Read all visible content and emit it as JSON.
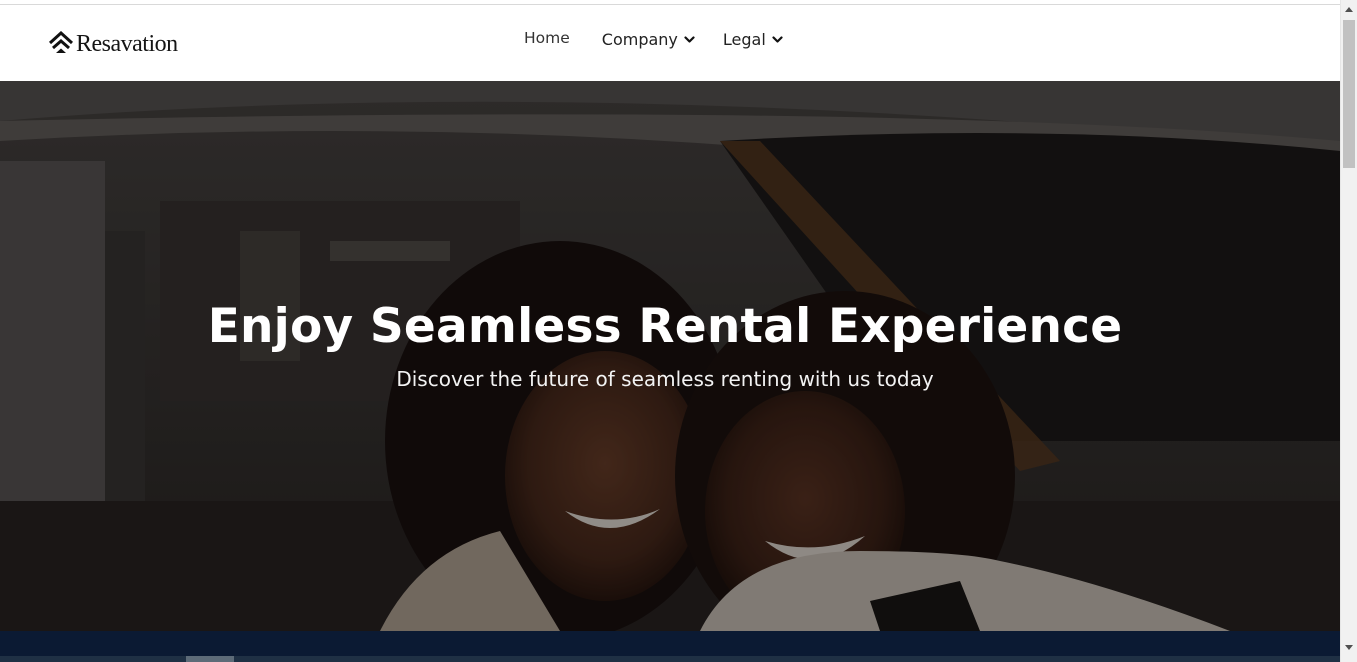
{
  "brand": {
    "name": "Resavation",
    "logo_icon": "stacked-chevrons-logo-icon"
  },
  "nav": {
    "home_label": "Home",
    "company_label": "Company",
    "legal_label": "Legal",
    "dropdown_icon": "chevron-down-icon"
  },
  "hero": {
    "title": "Enjoy Seamless Rental Experience",
    "subtitle": "Discover the future of seamless renting with us today",
    "image_subject": "two smiling women posing together outdoors",
    "overlay_color": "#000000"
  },
  "colors": {
    "nav_bg": "#ffffff",
    "footer_bg": "#0b1a33",
    "text_dark": "#222222",
    "hero_text": "#ffffff"
  }
}
